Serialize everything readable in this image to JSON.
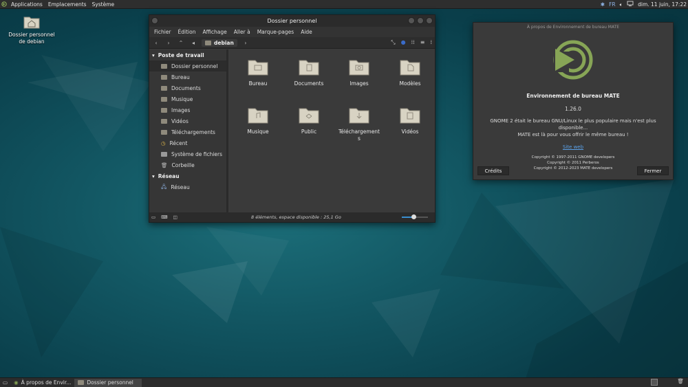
{
  "top_panel": {
    "menus": [
      "Applications",
      "Emplacements",
      "Système"
    ],
    "keyboard_layout": "FR",
    "clock": "dim. 11 juin, 17:22"
  },
  "desktop": {
    "home_icon_label": "Dossier personnel de debian"
  },
  "file_manager": {
    "title": "Dossier personnel",
    "menu": [
      "Fichier",
      "Édition",
      "Affichage",
      "Aller à",
      "Marque-pages",
      "Aide"
    ],
    "path_crumb": "debian",
    "sidebar": {
      "section_computer": "Poste de travail",
      "computer_items": [
        "Dossier personnel",
        "Bureau",
        "Documents",
        "Musique",
        "Images",
        "Vidéos",
        "Téléchargements",
        "Récent",
        "Système de fichiers",
        "Corbeille"
      ],
      "section_network": "Réseau",
      "network_items": [
        "Réseau"
      ]
    },
    "files": [
      "Bureau",
      "Documents",
      "Images",
      "Modèles",
      "Musique",
      "Public",
      "Téléchargements",
      "Vidéos"
    ],
    "status": "8 éléments, espace disponible : 25,1 Go",
    "zoom_fraction": 0.45
  },
  "about_dialog": {
    "title": "À propos de Environnement de bureau MATE",
    "app_name": "Environnement de bureau MATE",
    "version": "1.26.0",
    "comment_line1": "GNOME 2 était le bureau GNU/Linux le plus populaire mais n'est plus disponible...",
    "comment_line2": "MATE est là pour vous offrir le même bureau !",
    "website": "Site web",
    "copyright": [
      "Copyright © 1997-2011 GNOME developers",
      "Copyright © 2011 Perberos",
      "Copyright © 2012-2023 MATE developers"
    ],
    "credits_button": "Crédits",
    "close_button": "Fermer"
  },
  "bottom_panel": {
    "tasks": [
      "À propos de Envir...",
      "Dossier personnel"
    ]
  },
  "colors": {
    "mate_green": "#87a556",
    "link": "#5aa0e6",
    "accent_blue": "#3a8fd0"
  }
}
